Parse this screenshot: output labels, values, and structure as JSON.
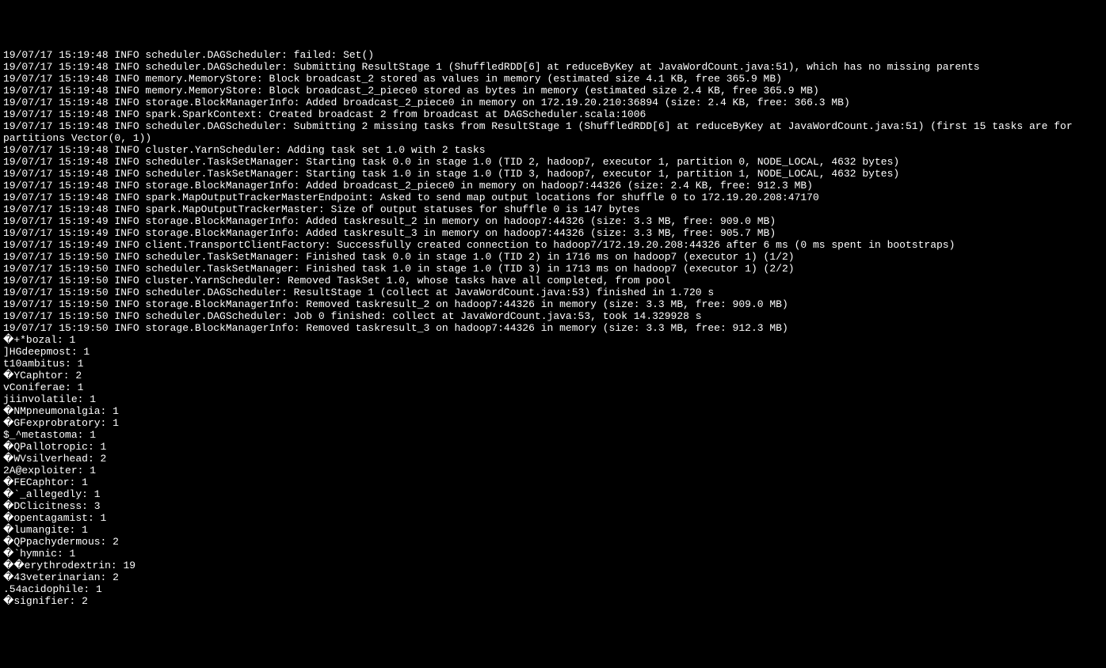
{
  "terminal": {
    "lines": [
      "19/07/17 15:19:48 INFO scheduler.DAGScheduler: failed: Set()",
      "19/07/17 15:19:48 INFO scheduler.DAGScheduler: Submitting ResultStage 1 (ShuffledRDD[6] at reduceByKey at JavaWordCount.java:51), which has no missing parents",
      "19/07/17 15:19:48 INFO memory.MemoryStore: Block broadcast_2 stored as values in memory (estimated size 4.1 KB, free 365.9 MB)",
      "19/07/17 15:19:48 INFO memory.MemoryStore: Block broadcast_2_piece0 stored as bytes in memory (estimated size 2.4 KB, free 365.9 MB)",
      "19/07/17 15:19:48 INFO storage.BlockManagerInfo: Added broadcast_2_piece0 in memory on 172.19.20.210:36894 (size: 2.4 KB, free: 366.3 MB)",
      "19/07/17 15:19:48 INFO spark.SparkContext: Created broadcast 2 from broadcast at DAGScheduler.scala:1006",
      "19/07/17 15:19:48 INFO scheduler.DAGScheduler: Submitting 2 missing tasks from ResultStage 1 (ShuffledRDD[6] at reduceByKey at JavaWordCount.java:51) (first 15 tasks are for",
      "partitions Vector(0, 1))",
      "19/07/17 15:19:48 INFO cluster.YarnScheduler: Adding task set 1.0 with 2 tasks",
      "19/07/17 15:19:48 INFO scheduler.TaskSetManager: Starting task 0.0 in stage 1.0 (TID 2, hadoop7, executor 1, partition 0, NODE_LOCAL, 4632 bytes)",
      "19/07/17 15:19:48 INFO scheduler.TaskSetManager: Starting task 1.0 in stage 1.0 (TID 3, hadoop7, executor 1, partition 1, NODE_LOCAL, 4632 bytes)",
      "19/07/17 15:19:48 INFO storage.BlockManagerInfo: Added broadcast_2_piece0 in memory on hadoop7:44326 (size: 2.4 KB, free: 912.3 MB)",
      "19/07/17 15:19:48 INFO spark.MapOutputTrackerMasterEndpoint: Asked to send map output locations for shuffle 0 to 172.19.20.208:47170",
      "19/07/17 15:19:48 INFO spark.MapOutputTrackerMaster: Size of output statuses for shuffle 0 is 147 bytes",
      "19/07/17 15:19:49 INFO storage.BlockManagerInfo: Added taskresult_2 in memory on hadoop7:44326 (size: 3.3 MB, free: 909.0 MB)",
      "19/07/17 15:19:49 INFO storage.BlockManagerInfo: Added taskresult_3 in memory on hadoop7:44326 (size: 3.3 MB, free: 905.7 MB)",
      "19/07/17 15:19:49 INFO client.TransportClientFactory: Successfully created connection to hadoop7/172.19.20.208:44326 after 6 ms (0 ms spent in bootstraps)",
      "19/07/17 15:19:50 INFO scheduler.TaskSetManager: Finished task 0.0 in stage 1.0 (TID 2) in 1716 ms on hadoop7 (executor 1) (1/2)",
      "19/07/17 15:19:50 INFO scheduler.TaskSetManager: Finished task 1.0 in stage 1.0 (TID 3) in 1713 ms on hadoop7 (executor 1) (2/2)",
      "19/07/17 15:19:50 INFO cluster.YarnScheduler: Removed TaskSet 1.0, whose tasks have all completed, from pool",
      "19/07/17 15:19:50 INFO scheduler.DAGScheduler: ResultStage 1 (collect at JavaWordCount.java:53) finished in 1.720 s",
      "19/07/17 15:19:50 INFO storage.BlockManagerInfo: Removed taskresult_2 on hadoop7:44326 in memory (size: 3.3 MB, free: 909.0 MB)",
      "19/07/17 15:19:50 INFO scheduler.DAGScheduler: Job 0 finished: collect at JavaWordCount.java:53, took 14.329928 s",
      "19/07/17 15:19:50 INFO storage.BlockManagerInfo: Removed taskresult_3 on hadoop7:44326 in memory (size: 3.3 MB, free: 912.3 MB)",
      "�+*bozal: 1",
      "]HGdeepmost: 1",
      "t10ambitus: 1",
      "�YCaphtor: 2",
      "vConiferae: 1",
      "jiinvolatile: 1",
      "�NMpneumonalgia: 1",
      "�GFexprobratory: 1",
      "$_^metastoma: 1",
      "�QPallotropic: 1",
      "�WVsilverhead: 2",
      "2A@exploiter: 1",
      "�FECaphtor: 1",
      "�`_allegedly: 1",
      "�DClicitness: 3",
      "�opentagamist: 1",
      "�lumangite: 1",
      "�QPpachydermous: 2",
      "�`hymnic: 1",
      "��erythrodextrin: 19",
      "�43veterinarian: 2",
      ".54acidophile: 1",
      "�signifier: 2"
    ]
  }
}
